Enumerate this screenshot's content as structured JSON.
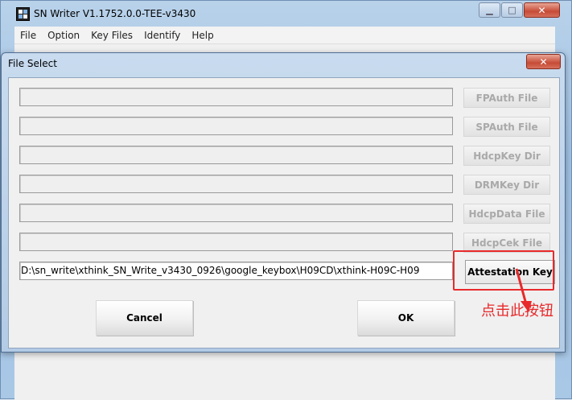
{
  "main_window": {
    "title": "SN Writer V1.1752.0.0-TEE-v3430",
    "minimize": "▁",
    "maximize": "□",
    "close": "✕",
    "menu": [
      "File",
      "Option",
      "Key Files",
      "Identify",
      "Help"
    ]
  },
  "dialog": {
    "title": "File Select",
    "close": "✕",
    "rows": [
      {
        "value": "",
        "button": "FPAuth File"
      },
      {
        "value": "",
        "button": "SPAuth File"
      },
      {
        "value": "",
        "button": "HdcpKey Dir"
      },
      {
        "value": "",
        "button": "DRMKey Dir"
      },
      {
        "value": "",
        "button": "HdcpData File"
      },
      {
        "value": "",
        "button": "HdcpCek File"
      },
      {
        "value": "D:\\sn_write\\xthink_SN_Write_v3430_0926\\google_keybox\\H09CD\\xthink-H09C-H09",
        "button": "Attestation Key"
      }
    ],
    "cancel": "Cancel",
    "ok": "OK"
  },
  "annotation": {
    "text": "点击此按钮",
    "color": "#e8292b"
  }
}
